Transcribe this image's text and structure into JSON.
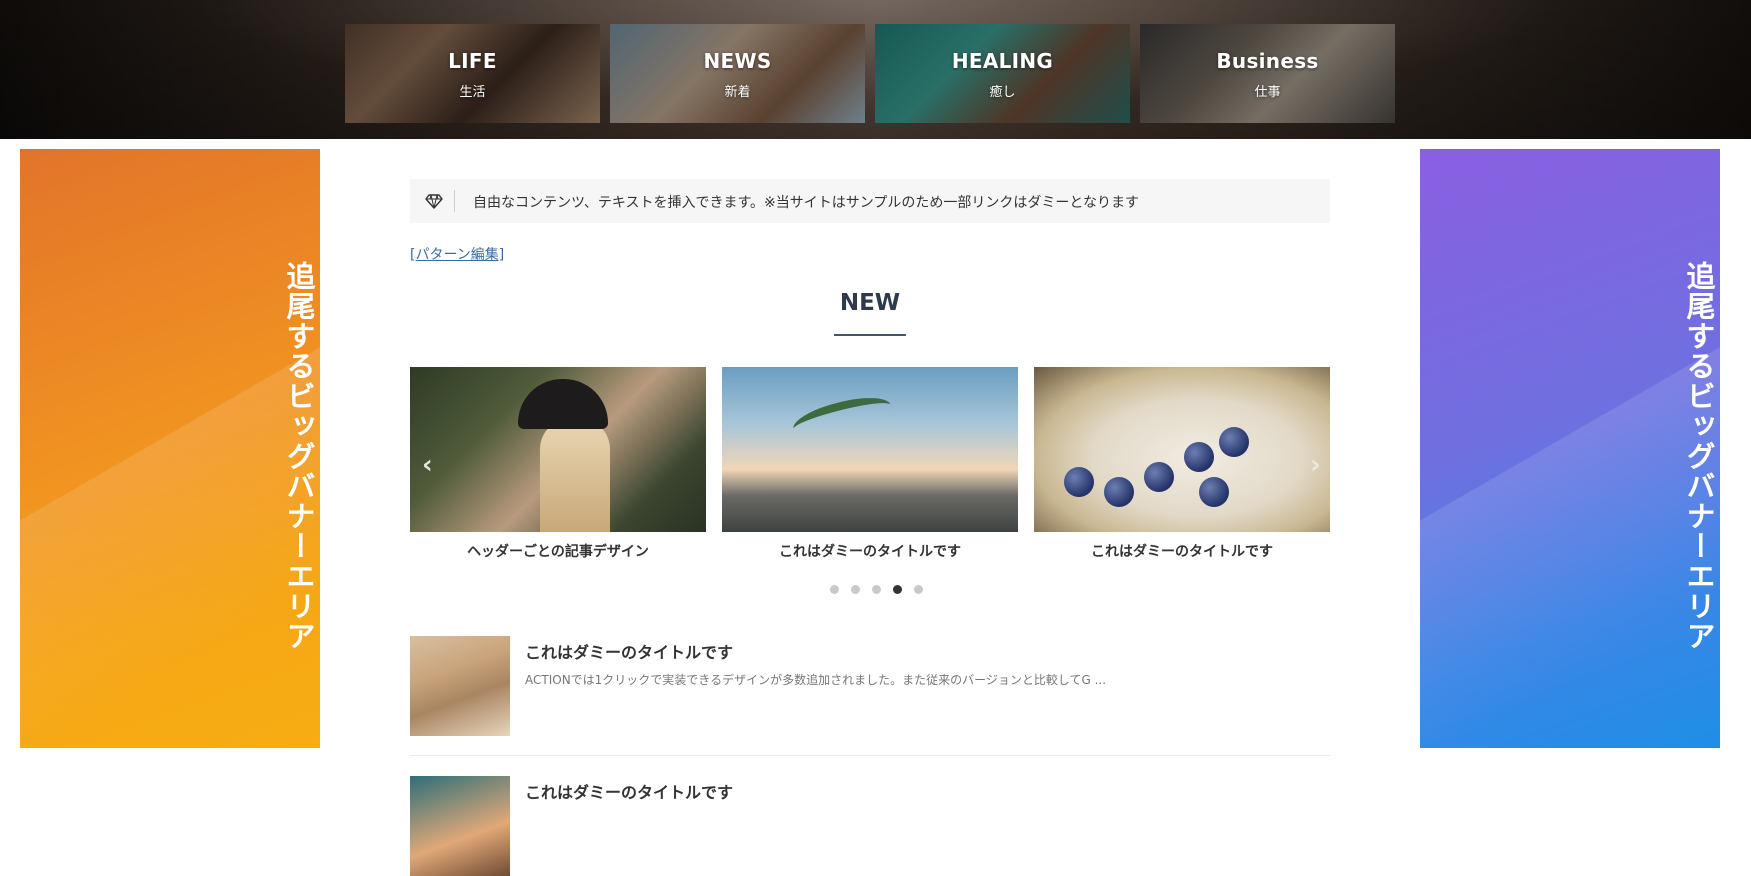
{
  "categories": [
    {
      "en": "LIFE",
      "ja": "生活"
    },
    {
      "en": "NEWS",
      "ja": "新着"
    },
    {
      "en": "HEALING",
      "ja": "癒し"
    },
    {
      "en": "Business",
      "ja": "仕事"
    }
  ],
  "banners": {
    "left_text": "追尾するビッグバナーエリア",
    "right_text": "追尾するビッグバナーエリア",
    "left_colors": [
      "#e2742a",
      "#f7ad13"
    ],
    "right_colors": [
      "#8a5fe1",
      "#1e8fe6"
    ]
  },
  "notice": {
    "icon": "gem-icon",
    "text": "自由なコンテンツ、テキストを挿入できます。※当サイトはサンプルのため一部リンクはダミーとなります"
  },
  "pattern_link": "[パターン編集]",
  "section": {
    "title": "NEW",
    "accent": "#3f5872"
  },
  "slider": {
    "slides": [
      {
        "caption": "ヘッダーごとの記事デザイン"
      },
      {
        "caption": "これはダミーのタイトルです"
      },
      {
        "caption": "これはダミーのタイトルです"
      }
    ],
    "dot_count": 5,
    "active_dot": 4
  },
  "posts": [
    {
      "title": "これはダミーのタイトルです",
      "excerpt": "ACTIONでは1クリックで実装できるデザインが多数追加されました。また従来のバージョンと比較してG ..."
    },
    {
      "title": "これはダミーのタイトルです",
      "excerpt": ""
    }
  ]
}
